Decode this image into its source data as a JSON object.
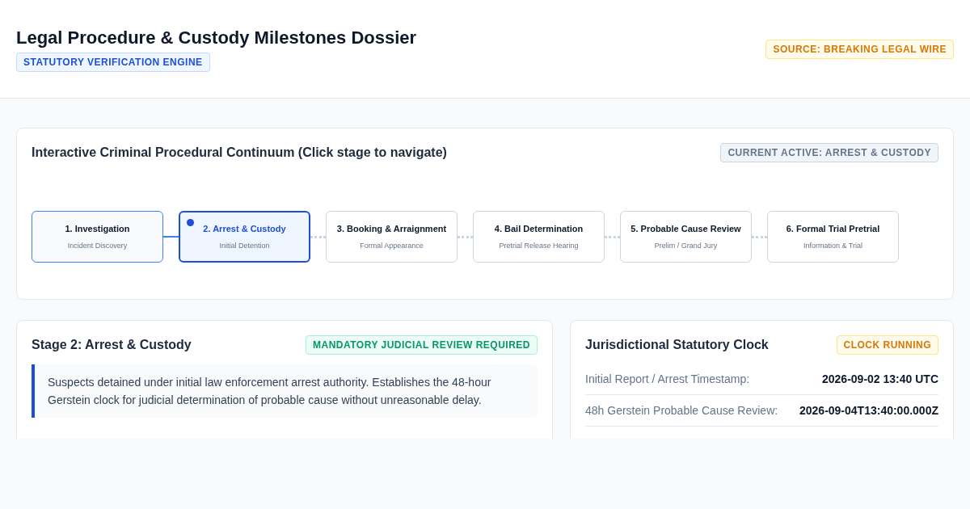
{
  "header": {
    "title": "Legal Procedure & Custody Milestones Dossier",
    "tag": "STATUTORY VERIFICATION ENGINE",
    "source": "SOURCE: BREAKING LEGAL WIRE"
  },
  "continuum": {
    "title": "Interactive Criminal Procedural Continuum (Click stage to navigate)",
    "current": "CURRENT ACTIVE: ARREST & CUSTODY",
    "stages": [
      {
        "label": "1. Investigation",
        "caption": "Incident Discovery",
        "completed": true,
        "selected": false
      },
      {
        "label": "2. Arrest & Custody",
        "caption": "Initial Detention",
        "completed": false,
        "selected": true
      },
      {
        "label": "3. Booking & Arraignment",
        "caption": "Formal Appearance",
        "completed": false,
        "selected": false
      },
      {
        "label": "4. Bail Determination",
        "caption": "Pretrial Release Hearing",
        "completed": false,
        "selected": false
      },
      {
        "label": "5. Probable Cause Review",
        "caption": "Prelim / Grand Jury",
        "completed": false,
        "selected": false
      },
      {
        "label": "6. Formal Trial Pretrial",
        "caption": "Information & Trial",
        "completed": false,
        "selected": false
      }
    ]
  },
  "stage_detail": {
    "title": "Stage 2: Arrest & Custody",
    "badge": "MANDATORY JUDICIAL REVIEW REQUIRED",
    "description": "Suspects detained under initial law enforcement arrest authority. Establishes the 48-hour Gerstein clock for judicial determination of probable cause without unreasonable delay."
  },
  "clock": {
    "title": "Jurisdictional Statutory Clock",
    "status": "CLOCK RUNNING",
    "rows": [
      {
        "label": "Initial Report / Arrest Timestamp:",
        "value": "2026-09-02 13:40 UTC"
      },
      {
        "label": "48h Gerstein Probable Cause Review:",
        "value": "2026-09-04T13:40:00.000Z"
      }
    ]
  }
}
